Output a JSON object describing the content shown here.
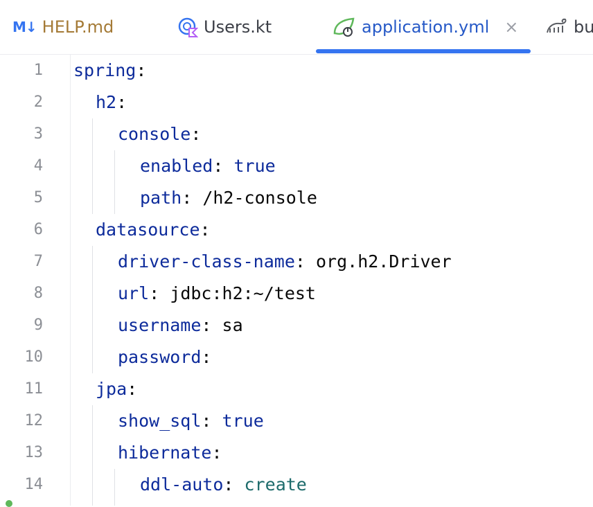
{
  "tabs": [
    {
      "id": "help",
      "icon": "markdown-icon",
      "icon_text": "M↓",
      "label": "HELP.md",
      "active": false
    },
    {
      "id": "users",
      "icon": "kotlin-class-icon",
      "label": "Users.kt",
      "active": false
    },
    {
      "id": "app",
      "icon": "spring-boot-icon",
      "label": "application.yml",
      "active": true,
      "close_symbol": "×"
    },
    {
      "id": "build",
      "icon": "gradle-elephant-icon",
      "label": "bu",
      "active": false
    }
  ],
  "line_numbers": [
    "1",
    "2",
    "3",
    "4",
    "5",
    "6",
    "7",
    "8",
    "9",
    "10",
    "11",
    "12",
    "13",
    "14"
  ],
  "code": [
    {
      "key": "spring",
      "colon": ":",
      "value": ""
    },
    {
      "key": "h2",
      "colon": ":",
      "value": ""
    },
    {
      "key": "console",
      "colon": ":",
      "value": ""
    },
    {
      "key": "enabled",
      "colon": ":",
      "value": " true"
    },
    {
      "key": "path",
      "colon": ":",
      "value": " /h2-console"
    },
    {
      "key": "datasource",
      "colon": ":",
      "value": ""
    },
    {
      "key": "driver-class-name",
      "colon": ":",
      "value": " org.h2.Driver"
    },
    {
      "key": "url",
      "colon": ":",
      "value": " jdbc:h2:~/test"
    },
    {
      "key": "username",
      "colon": ":",
      "value": " sa"
    },
    {
      "key": "password",
      "colon": ":",
      "value": ""
    },
    {
      "key": "jpa",
      "colon": ":",
      "value": ""
    },
    {
      "key": "show_sql",
      "colon": ":",
      "value": " true"
    },
    {
      "key": "hibernate",
      "colon": ":",
      "value": ""
    },
    {
      "key": "ddl-auto",
      "colon": ":",
      "value": " create"
    }
  ],
  "colors": {
    "accent": "#3574f0",
    "key": "#0d2b9b",
    "enum_value": "#1d6b6b",
    "help_tab": "#a47a36"
  }
}
